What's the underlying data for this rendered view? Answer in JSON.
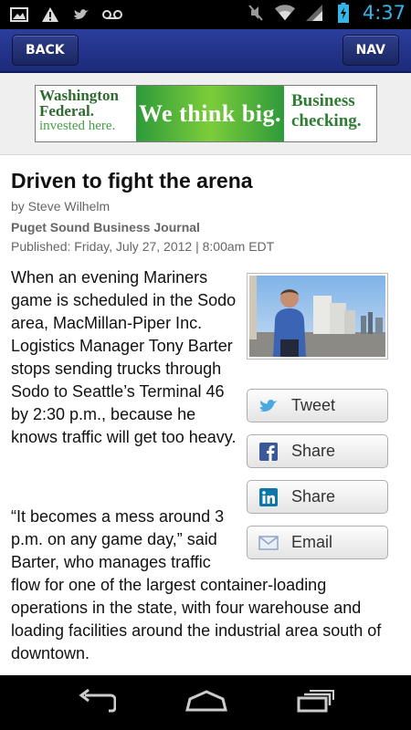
{
  "status_bar": {
    "time": "4:37",
    "left_icons": [
      "image-icon",
      "warning-icon",
      "twitter-icon",
      "voicemail-icon"
    ],
    "right_icons": [
      "mute-icon",
      "wifi-icon",
      "signal-icon",
      "battery-icon"
    ],
    "time_color": "#33b5e5"
  },
  "header": {
    "back_label": "BACK",
    "nav_label": "NAV",
    "bar_color": "#24358c"
  },
  "ad": {
    "brand_line1": "Washington",
    "brand_line2": "Federal.",
    "brand_line3": "invested here.",
    "slogan": "We think big.",
    "offer_line1": "Business",
    "offer_line2": "checking."
  },
  "article": {
    "title": "Driven to fight the arena",
    "byline": "by Steve Wilhelm",
    "publication": "Puget Sound Business Journal",
    "published": "Published: Friday, July 27, 2012 | 8:00am EDT",
    "paragraph1": "When an evening Mariners game is scheduled in the Sodo area, MacMillan-Piper Inc. Logistics Manager Tony Barter stops sending trucks through Sodo to Seattle’s Terminal 46 by 2:30 p.m., because he knows traffic will get too heavy.",
    "paragraph2_part1": "“It becomes a mess around 3 p.m. on any game day,” said Barter, who manages traffic",
    "paragraph2_part2": "flow for one of the largest container-loading operations in the state, with four warehouse and loading facilities around the industrial area south of downtown."
  },
  "share_buttons": [
    {
      "label": "Tweet",
      "icon": "twitter-icon"
    },
    {
      "label": "Share",
      "icon": "facebook-icon"
    },
    {
      "label": "Share",
      "icon": "linkedin-icon"
    },
    {
      "label": "Email",
      "icon": "email-icon"
    }
  ],
  "nav_bar": {
    "icons": [
      "back-nav-icon",
      "home-nav-icon",
      "recent-apps-icon"
    ]
  }
}
